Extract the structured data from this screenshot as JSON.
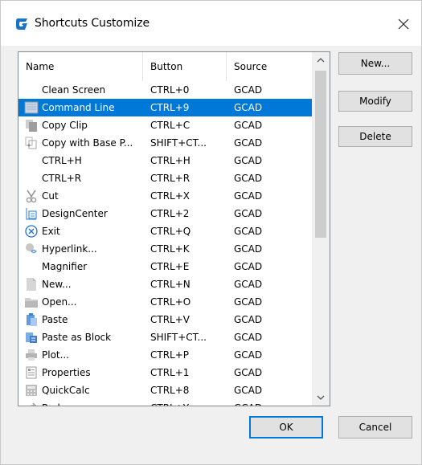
{
  "window": {
    "title": "Shortcuts Customize"
  },
  "table": {
    "columns": [
      "Name",
      "Button",
      "Source"
    ],
    "rows": [
      {
        "name": "Clean Screen",
        "button": "CTRL+0",
        "source": "GCAD",
        "icon": "none"
      },
      {
        "name": "Command Line",
        "button": "CTRL+9",
        "source": "GCAD",
        "icon": "command-line-icon",
        "selected": true
      },
      {
        "name": "Copy Clip",
        "button": "CTRL+C",
        "source": "GCAD",
        "icon": "copy-clip-icon"
      },
      {
        "name": "Copy with Base P...",
        "button": "SHIFT+CT...",
        "source": "GCAD",
        "icon": "copy-base-icon"
      },
      {
        "name": "CTRL+H",
        "button": "CTRL+H",
        "source": "GCAD",
        "icon": "none"
      },
      {
        "name": "CTRL+R",
        "button": "CTRL+R",
        "source": "GCAD",
        "icon": "none"
      },
      {
        "name": "Cut",
        "button": "CTRL+X",
        "source": "GCAD",
        "icon": "cut-icon"
      },
      {
        "name": "DesignCenter",
        "button": "CTRL+2",
        "source": "GCAD",
        "icon": "design-center-icon"
      },
      {
        "name": "Exit",
        "button": "CTRL+Q",
        "source": "GCAD",
        "icon": "exit-icon"
      },
      {
        "name": "Hyperlink...",
        "button": "CTRL+K",
        "source": "GCAD",
        "icon": "hyperlink-icon"
      },
      {
        "name": "Magnifier",
        "button": "CTRL+E",
        "source": "GCAD",
        "icon": "none"
      },
      {
        "name": "New...",
        "button": "CTRL+N",
        "source": "GCAD",
        "icon": "new-file-icon"
      },
      {
        "name": "Open...",
        "button": "CTRL+O",
        "source": "GCAD",
        "icon": "open-folder-icon"
      },
      {
        "name": "Paste",
        "button": "CTRL+V",
        "source": "GCAD",
        "icon": "paste-icon"
      },
      {
        "name": "Paste as Block",
        "button": "SHIFT+CT...",
        "source": "GCAD",
        "icon": "paste-block-icon"
      },
      {
        "name": "Plot...",
        "button": "CTRL+P",
        "source": "GCAD",
        "icon": "plot-icon"
      },
      {
        "name": "Properties",
        "button": "CTRL+1",
        "source": "GCAD",
        "icon": "properties-icon"
      },
      {
        "name": "QuickCalc",
        "button": "CTRL+8",
        "source": "GCAD",
        "icon": "quickcalc-icon"
      },
      {
        "name": "Redo",
        "button": "CTRL+Y",
        "source": "GCAD",
        "icon": "redo-icon"
      }
    ]
  },
  "buttons": {
    "new_label": "New...",
    "modify_label": "Modify",
    "delete_label": "Delete",
    "ok_label": "OK",
    "cancel_label": "Cancel"
  },
  "colors": {
    "selection": "#0078d7",
    "app_icon": "#1a73c8"
  }
}
